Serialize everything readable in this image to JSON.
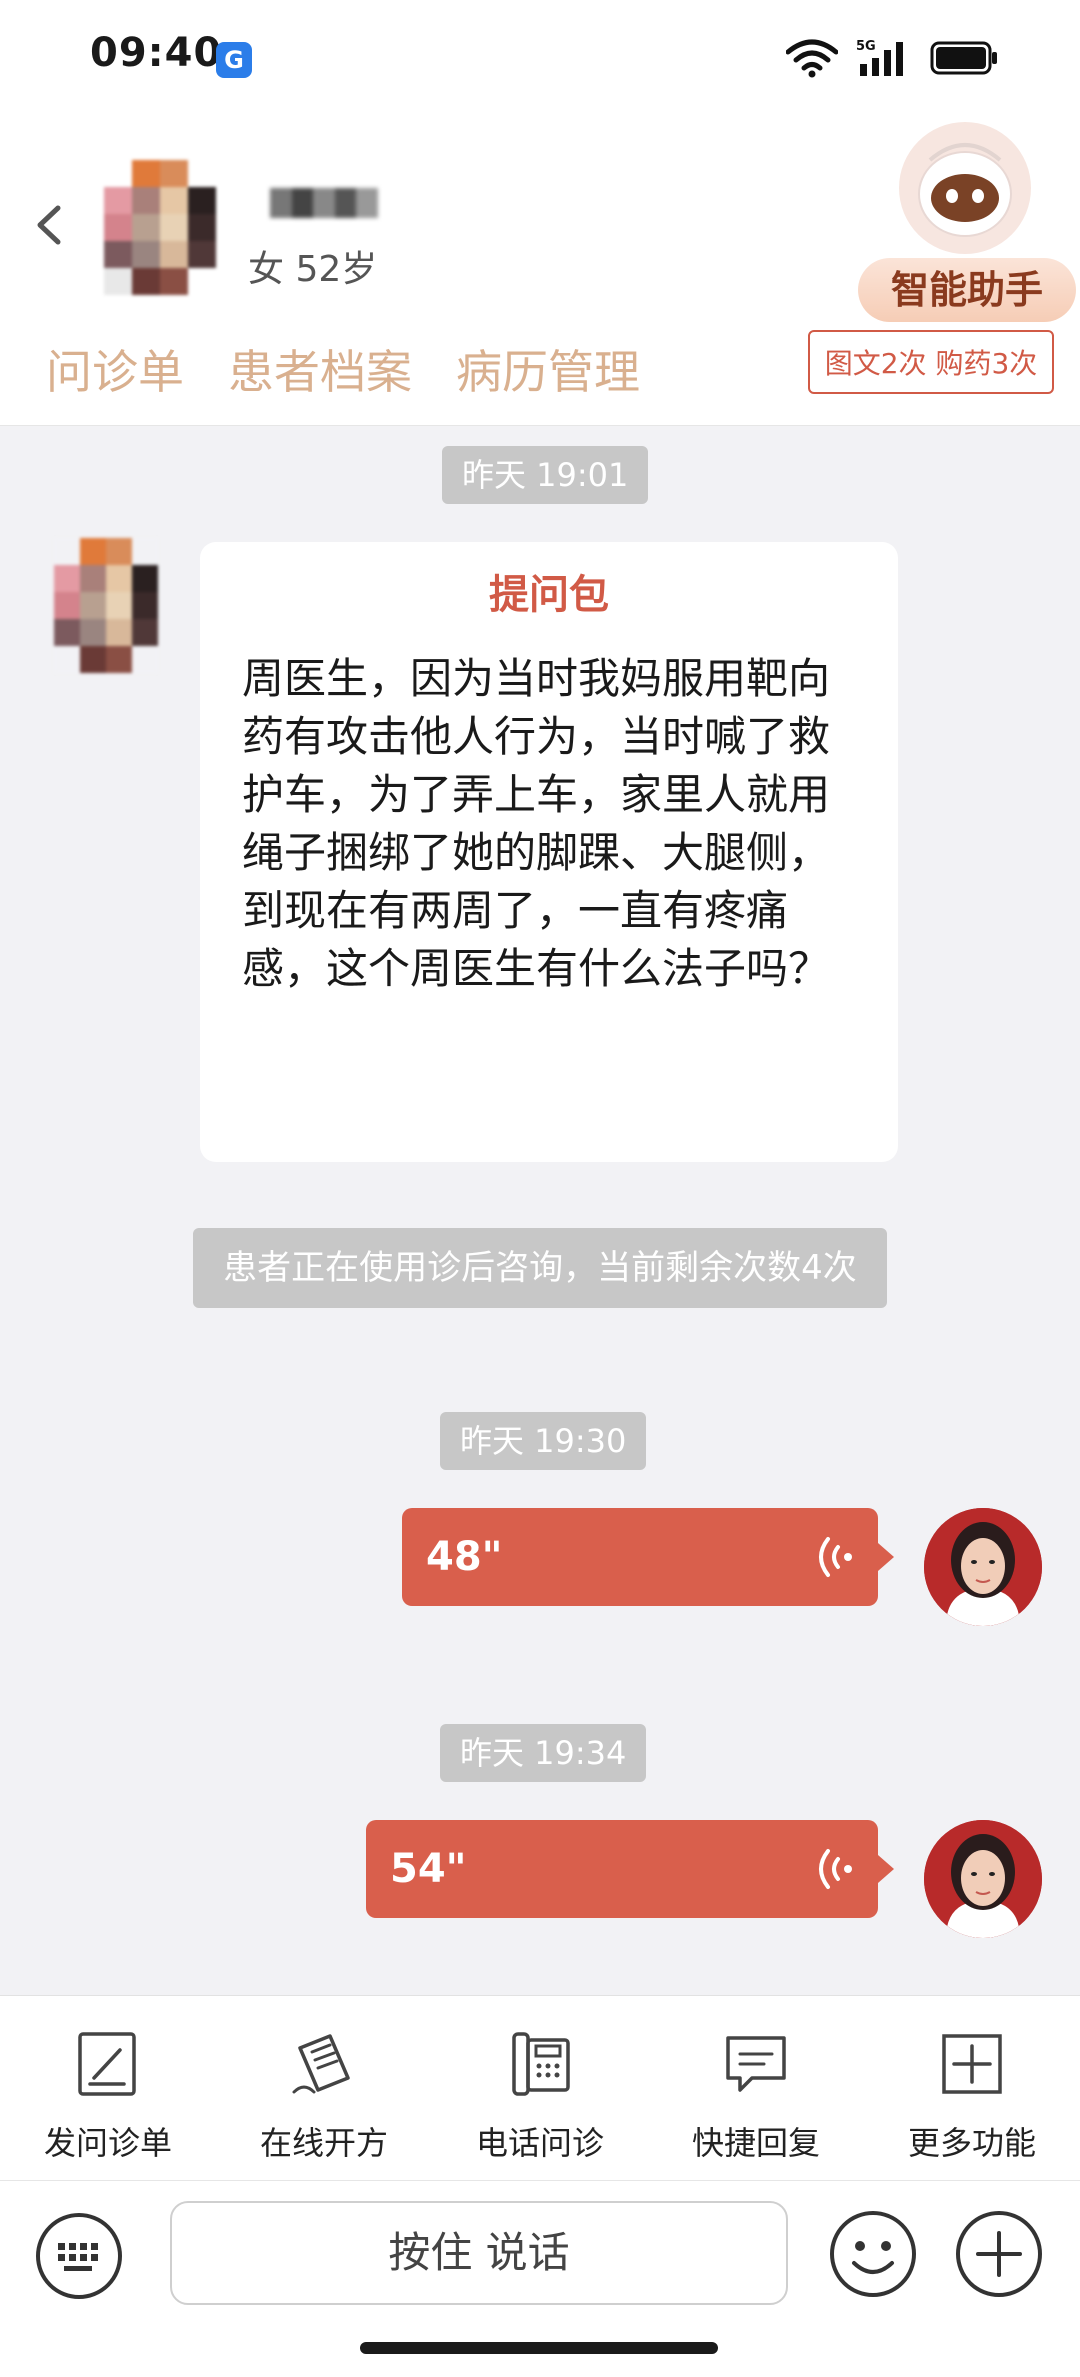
{
  "status_bar": {
    "time": "09:40",
    "network": "5G"
  },
  "header": {
    "patient_info": "女 52岁",
    "assistant_label": "智能助手",
    "tabs": [
      "问诊单",
      "患者档案",
      "病历管理"
    ],
    "quota": "图文2次 购药3次"
  },
  "chat": {
    "messages": [
      {
        "timestamp": "昨天 19:01"
      },
      {
        "card_title": "提问包",
        "card_text": "周医生，因为当时我妈服用靶向药有攻击他人行为，当时喊了救护车，为了弄上车，家里人就用绳子捆绑了她的脚踝、大腿侧，到现在有两周了，一直有疼痛感，这个周医生有什么法子吗？"
      },
      {
        "notice": "患者正在使用诊后咨询，当前剩余次数4次"
      },
      {
        "timestamp": "昨天 19:30",
        "voice_duration": "48\""
      },
      {
        "timestamp": "昨天 19:34",
        "voice_duration": "54\""
      }
    ]
  },
  "toolbar": {
    "items": [
      {
        "label": "发问诊单",
        "icon": "form-pen-icon"
      },
      {
        "label": "在线开方",
        "icon": "prescription-icon"
      },
      {
        "label": "电话问诊",
        "icon": "phone-icon"
      },
      {
        "label": "快捷回复",
        "icon": "chat-bubble-icon"
      },
      {
        "label": "更多功能",
        "icon": "plus-square-icon"
      }
    ]
  },
  "input_bar": {
    "hold_to_talk": "按住 说话"
  },
  "colors": {
    "accent": "#d95f4c",
    "tab_text": "#d9b08f",
    "timestamp_bg": "#c7c7c7"
  }
}
